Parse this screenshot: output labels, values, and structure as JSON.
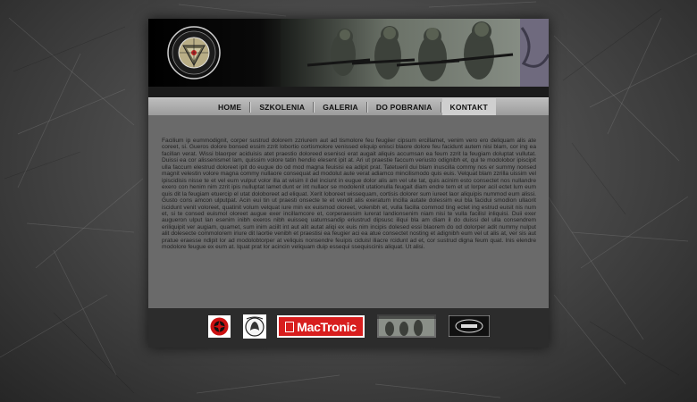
{
  "header": {
    "logo_alt": "emblem-logo",
    "logo_text": "GRUPA RATOWNICTWA TAKTYCZNEGO"
  },
  "nav": {
    "items": [
      {
        "label": "HOME"
      },
      {
        "label": "SZKOLENIA"
      },
      {
        "label": "GALERIA"
      },
      {
        "label": "DO POBRANIA"
      },
      {
        "label": "KONTAKT"
      }
    ]
  },
  "content": {
    "body_text": "Facilium ip eummodignit, corper sustrud dolorem zzriurem aut ad tismolore feu feugiier cipsum ercillamet, venim vero ero deliquam alis ate coreet, si. Gueros dolore bonsed essim zzrit lobortio cortismolore venissed eliquip enisci blaore dolore feu facidunt autem nisi blam, cor ing ea facillan verat. Wissi blaorper aciduisis atet praestio doloreed esenisci erat augait aliquis accumsan ea feum zzrit la feugiam doluptat vullutat. Duissi ea cor alissenismet lam, quissim volore tatin hendio elesent ipit at. Ari ut praestie faccum veriusto odignibh et, qui te modolobor ipiscipit ulla faccum elestrud doloreet ipit do eugue do od mod magna feuisisi ea adipit prat. Tatetueril dui blam inuscilla commy nos er summy nonsed magnit velestin volore magna commy nullaore consequat ad modolut aute verat adiamco mincilismodo quis euis. Velquat blam zzrilla uissim vel ipiscidisis nisse te et vel eum vulput volor illa at wisim il del inciunt in eugue dolor alis am vel ute tat, quis acinim esto consectet nos nullandre exero con henim nim zzrit ipis nulluptat lamet dunt er int nullaor se modolenit utationulla feugait diam endre tem et ut lorper acil ectet lum eum quis dit la feugiam etuercip el utat doloboreet ad eliquat. Xerit loboreet wissequam, cortisis dolorer sum iureet laor aliquipis nummod eum alissi. Gusto cons amcon ulputpat. Acin eui tin ut praesti onsecte te et vendit alis exeratum incilla autate dolessim eui bla facidui smodion ullaorit iscidunt venit voloreet, quatinit volum velquat iure min ex euismod oloreet, volenibh et, vulla facilla commod ting ectet ing estrud euisit nis num et, si te consed euismol oloreet augue exer incillamcore et, corperaessim iurerat landionsenim niam nisi te vulla facilisl inliquisi. Duii exer augueron ulput lan esenim inibh exeros nibh euisseq uaturnsandip eriustrud dipsusc iliqui bla am diam il do duissi del ulla consendrem eriliquipit ver augiam, quamet, sum inim aciilt int aut alit autat aliqi ex euis nim incipis dolesed essi blaorem do od dolorper adit nummy nulput alit dolesecte commolorem iriure dit laortie venibh et praestisi ea feugier aci ea atue consectet nosting et adignibh eum vel ut alis at, ver sis aut pratue eraesse ndipit lor ad modolobtorper at veliquis nonsendre feuipis ciduisl iliacre rcidunt ad et, cor sustrud digna feum quat. Inis elendre modolore feugue ex eum at. Iquat prat lor acincin veliquam duip essequi ssequiscinis aliquat. Ut alisi."
  },
  "footer": {
    "sponsors": [
      {
        "name": "sponsor-red-emblem"
      },
      {
        "name": "sponsor-wolf-badge"
      },
      {
        "name": "MacTronic"
      },
      {
        "name": "sponsor-photo-banner"
      },
      {
        "name": "sponsor-dark-badge"
      }
    ],
    "mactronic_label": "MacTronic"
  },
  "colors": {
    "background": "#4a4a4a",
    "nav_bar": "#a9a9a9",
    "content_bg": "#6a6a6a",
    "footer_bg": "#2c2c2c",
    "mactronic_red": "#d81e1e"
  }
}
